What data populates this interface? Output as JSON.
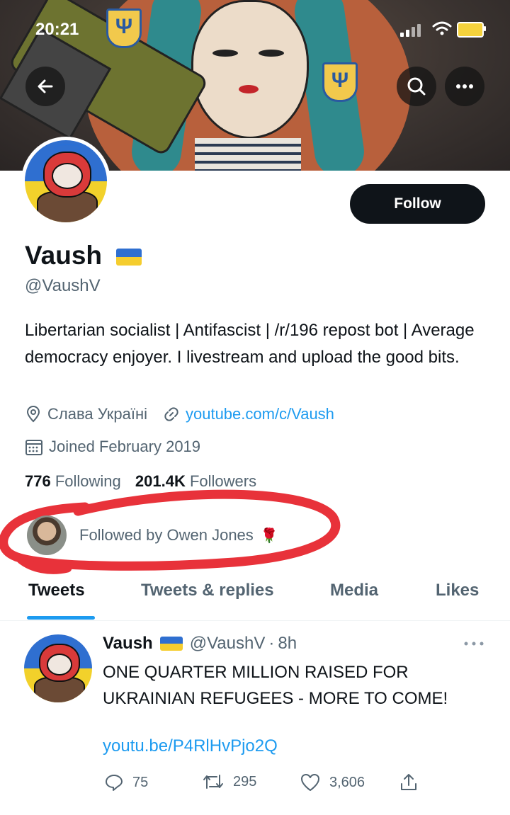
{
  "status_bar": {
    "time": "20:21"
  },
  "profile": {
    "name": "Vaush",
    "handle": "@VaushV",
    "follow_label": "Follow",
    "bio": "Libertarian socialist | Antifascist | /r/196 repost bot | Average democracy enjoyer. I livestream and upload the good bits.",
    "location": "Слава Україні",
    "website": "youtube.com/c/Vaush",
    "joined": "Joined February 2019",
    "following_count": "776",
    "following_label": "Following",
    "followers_count": "201.4K",
    "followers_label": "Followers",
    "followed_by": "Followed by Owen Jones"
  },
  "tabs": [
    "Tweets",
    "Tweets & replies",
    "Media",
    "Likes"
  ],
  "active_tab": "Tweets",
  "tweet": {
    "author": "Vaush",
    "handle": "@VaushV",
    "time": "8h",
    "text": "ONE QUARTER MILLION RAISED FOR UKRAINIAN REFUGEES - MORE TO COME!",
    "link": "youtu.be/P4RlHvPjo2Q",
    "replies": "75",
    "retweets": "295",
    "likes": "3,606"
  },
  "colors": {
    "accent": "#1d9bf0",
    "annotation": "#e8323a",
    "text_secondary": "#536471"
  },
  "icons": [
    "back-arrow-icon",
    "search-icon",
    "more-icon",
    "location-pin-icon",
    "link-icon",
    "calendar-icon",
    "reply-icon",
    "retweet-icon",
    "like-icon",
    "share-icon",
    "rose-icon"
  ]
}
